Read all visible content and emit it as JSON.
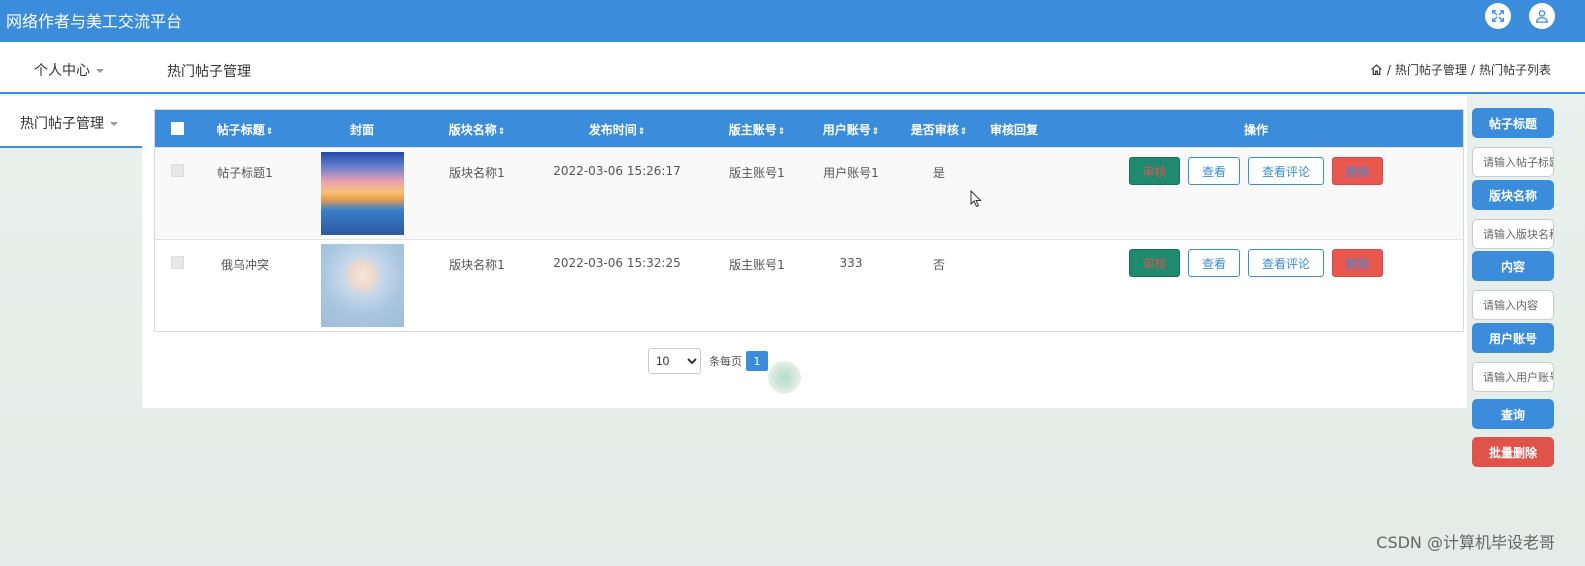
{
  "app": {
    "title": "网络作者与美工交流平台"
  },
  "topbar": {
    "fullscreen_icon": "fullscreen-icon",
    "user_icon": "user-icon"
  },
  "nav": {
    "personal_center": "个人中心",
    "page_title": "热门帖子管理",
    "breadcrumb": {
      "home_icon": "home-icon",
      "sep": "/",
      "level1": "热门帖子管理",
      "level2": "热门帖子列表"
    }
  },
  "sidebar": {
    "items": [
      {
        "label": "热门帖子管理"
      }
    ]
  },
  "table": {
    "headers": {
      "title": "帖子标题",
      "cover": "封面",
      "board_name": "版块名称",
      "publish_time": "发布时间",
      "moderator_account": "版主账号",
      "user_account": "用户账号",
      "audited": "是否审核",
      "audit_reply": "审核回复",
      "actions": "操作"
    },
    "sort_icon": "⇕",
    "rows": [
      {
        "title": "帖子标题1",
        "board_name": "版块名称1",
        "publish_time": "2022-03-06 15:26:17",
        "moderator_account": "版主账号1",
        "user_account": "用户账号1",
        "audited": "是",
        "audit_reply": ""
      },
      {
        "title": "俄乌冲突",
        "board_name": "版块名称1",
        "publish_time": "2022-03-06 15:32:25",
        "moderator_account": "版主账号1",
        "user_account": "333",
        "audited": "否",
        "audit_reply": ""
      }
    ],
    "action_labels": {
      "audit": "审核",
      "view": "查看",
      "view_comments": "查看评论",
      "delete": "删除"
    }
  },
  "pagination": {
    "page_size": "10",
    "per_page_label": "条每页",
    "current_page": "1"
  },
  "search": {
    "title_label": "帖子标题",
    "title_placeholder": "请输入帖子标题",
    "board_label": "版块名称",
    "board_placeholder": "请输入版块名称",
    "content_label": "内容",
    "content_placeholder": "请输入内容",
    "user_label": "用户账号",
    "user_placeholder": "请输入用户账号",
    "query_button": "查询",
    "batch_delete_button": "批量删除"
  },
  "colors": {
    "primary": "#3b8ddb",
    "audit_green": "#1f8a6e",
    "danger": "#e0534b"
  },
  "watermark": "CSDN @计算机毕设老哥"
}
